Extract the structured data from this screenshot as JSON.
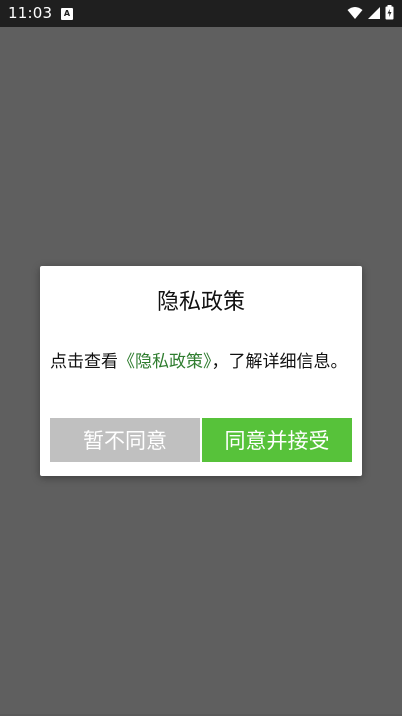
{
  "status_bar": {
    "time": "11:03",
    "app_icon_letter": "A",
    "icons": [
      "wifi-icon",
      "signal-icon",
      "battery-icon"
    ]
  },
  "dialog": {
    "title": "隐私政策",
    "body_prefix": "点击查看",
    "policy_link": "《隐私政策》",
    "body_suffix": "，了解详细信息。",
    "decline_label": "暂不同意",
    "accept_label": "同意并接受"
  },
  "colors": {
    "overlay": "#5f5f5f",
    "link": "#2f7d2f",
    "accept": "#57c23a",
    "decline": "#c0c0c0"
  }
}
